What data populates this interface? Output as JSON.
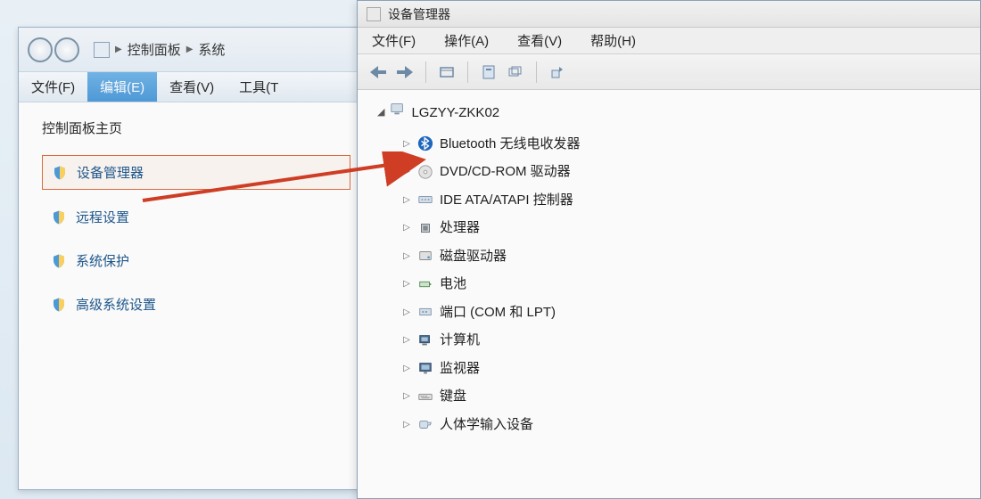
{
  "cp": {
    "breadcrumb": {
      "item1": "控制面板",
      "item2": "系统"
    },
    "menubar": {
      "file": "文件(F)",
      "edit": "编辑(E)",
      "view": "查看(V)",
      "tools": "工具(T"
    },
    "heading": "控制面板主页",
    "links": {
      "device_manager": "设备管理器",
      "remote_settings": "远程设置",
      "system_protection": "系统保护",
      "advanced_settings": "高级系统设置"
    }
  },
  "dm": {
    "title": "设备管理器",
    "menubar": {
      "file": "文件(F)",
      "action": "操作(A)",
      "view": "查看(V)",
      "help": "帮助(H)"
    },
    "root": "LGZYY-ZKK02",
    "items": [
      {
        "icon": "bluetooth",
        "label": "Bluetooth 无线电收发器"
      },
      {
        "icon": "dvd",
        "label": "DVD/CD-ROM 驱动器"
      },
      {
        "icon": "ide",
        "label": "IDE ATA/ATAPI 控制器"
      },
      {
        "icon": "cpu",
        "label": "处理器"
      },
      {
        "icon": "disk",
        "label": "磁盘驱动器"
      },
      {
        "icon": "battery",
        "label": "电池"
      },
      {
        "icon": "port",
        "label": "端口 (COM 和 LPT)"
      },
      {
        "icon": "computer",
        "label": "计算机"
      },
      {
        "icon": "monitor",
        "label": "监视器"
      },
      {
        "icon": "keyboard",
        "label": "键盘"
      },
      {
        "icon": "hid",
        "label": "人体学输入设备"
      }
    ]
  }
}
